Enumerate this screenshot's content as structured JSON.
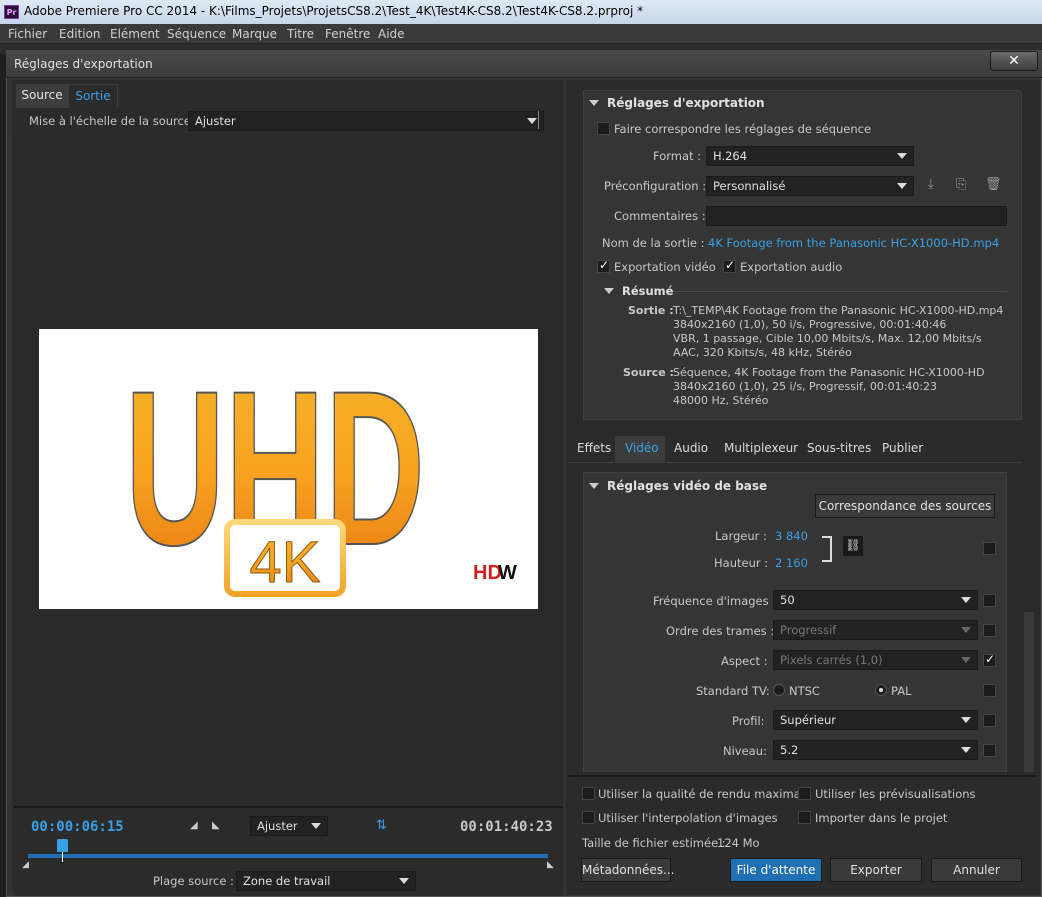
{
  "window": {
    "title": "Adobe Premiere Pro CC 2014 - K:\\Films_Projets\\ProjetsCS8.2\\Test_4K\\Test4K-CS8.2\\Test4K-CS8.2.prproj *",
    "app_icon": "Pr"
  },
  "menu": [
    "Fichier",
    "Edition",
    "Elément",
    "Séquence",
    "Marque",
    "Titre",
    "Fenêtre",
    "Aide"
  ],
  "dialog": {
    "title": "Réglages d'exportation",
    "close": "✕"
  },
  "left": {
    "tabs": [
      "Source",
      "Sortie"
    ],
    "scale_label": "Mise à l'échelle de la source :",
    "scale_value": "Ajuster",
    "preview_text": {
      "main": "UHD",
      "badge": "4K",
      "logo_red": "HD",
      "logo_black": "W"
    },
    "timeline": {
      "current": "00:00:06:15",
      "fit": "Ajuster",
      "duration": "00:01:40:23",
      "range_label": "Plage source :",
      "range_value": "Zone de travail"
    }
  },
  "export": {
    "section": "Réglages d'exportation",
    "match_seq": "Faire correspondre les réglages de séquence",
    "format_label": "Format :",
    "format_value": "H.264",
    "preset_label": "Préconfiguration :",
    "preset_value": "Personnalisé",
    "comments_label": "Commentaires :",
    "output_label": "Nom de la sortie :",
    "output_value": "4K Footage from the Panasonic HC-X1000-HD.mp4",
    "export_video": "Exportation vidéo",
    "export_audio": "Exportation audio",
    "summary": "Résumé",
    "sortie_label": "Sortie :",
    "sortie_lines": [
      "T:\\_TEMP\\4K Footage from the Panasonic HC-X1000-HD.mp4",
      "3840x2160 (1,0), 50 i/s, Progressive, 00:01:40:46",
      "VBR, 1 passage, Cible 10,00  Mbits/s, Max. 12,00  Mbits/s",
      "AAC, 320  Kbits/s, 48  kHz, Stéréo"
    ],
    "source_label": "Source :",
    "source_lines": [
      "Séquence, 4K Footage from the Panasonic HC-X1000-HD",
      "3840x2160 (1,0), 25  i/s, Progressif, 00:01:40:23",
      "48000 Hz, Stéréo"
    ]
  },
  "tabs": [
    "Effets",
    "Vidéo",
    "Audio",
    "Multiplexeur",
    "Sous-titres",
    "Publier"
  ],
  "video": {
    "section": "Réglages vidéo de base",
    "match_btn": "Correspondance des sources",
    "width_label": "Largeur :",
    "width_value": "3 840",
    "height_label": "Hauteur :",
    "height_value": "2 160",
    "fps_label": "Fréquence d'images :",
    "fps_value": "50",
    "field_label": "Ordre des trames :",
    "field_value": "Progressif",
    "aspect_label": "Aspect :",
    "aspect_value": "Pixels carrés (1,0)",
    "tv_label": "Standard TV:",
    "ntsc": "NTSC",
    "pal": "PAL",
    "profile_label": "Profil:",
    "profile_value": "Supérieur",
    "level_label": "Niveau:",
    "level_value": "5.2"
  },
  "bottom": {
    "max_render": "Utiliser la qualité de rendu maximale",
    "use_previews": "Utiliser les prévisualisations",
    "interp": "Utiliser l'interpolation d'images",
    "import_proj": "Importer dans le projet",
    "size_label": "Taille de fichier estimée :",
    "size_value": "124 Mo",
    "metadata": "Métadonnées...",
    "queue": "File d'attente",
    "export": "Exporter",
    "cancel": "Annuler"
  },
  "colors": {
    "accent": "#3aa0e6",
    "queue_btn": "#1f6fb4"
  }
}
